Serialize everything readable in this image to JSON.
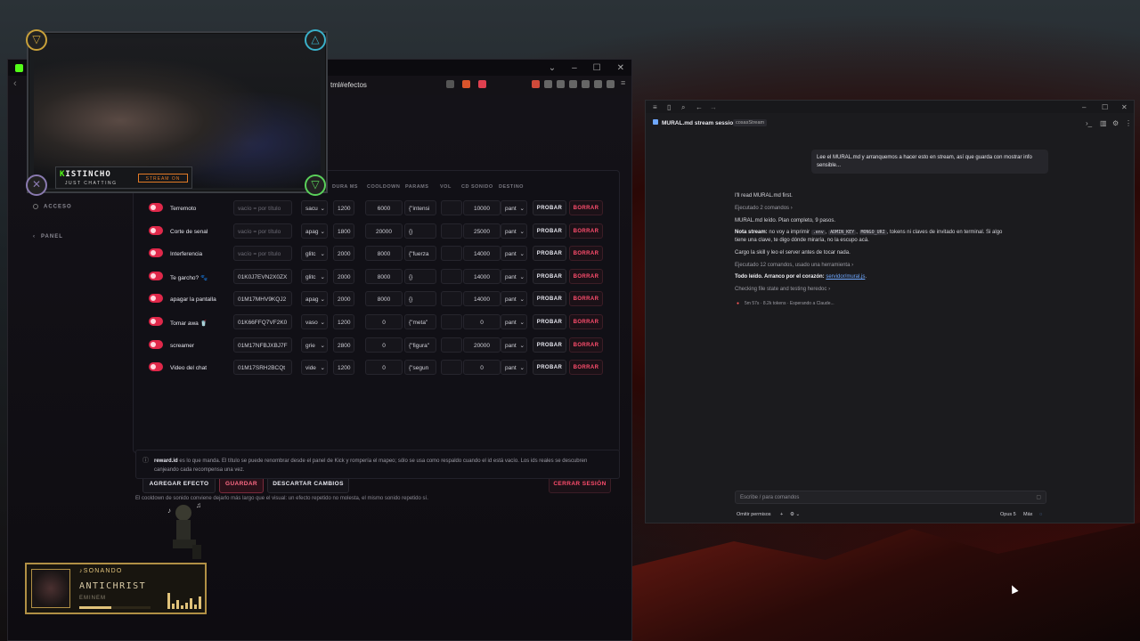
{
  "browser": {
    "url": "tml#efectos",
    "sidebar": [
      {
        "label": "ACCESO"
      },
      {
        "label": "PANEL"
      }
    ],
    "columns": [
      "DURA MS",
      "COOLDOWN",
      "PARAMS",
      "VOL",
      "CD SONIDO",
      "DESTINO"
    ],
    "placeholder_title": "vacío = por título",
    "effects": [
      {
        "name": "Terremoto",
        "reward_id": "vacío = por título",
        "reward_is_placeholder": true,
        "type": "sacu",
        "duration": "1200",
        "cooldown": "6000",
        "params": "{\"intensi",
        "sound_cd": "10000",
        "target": "pant"
      },
      {
        "name": "Corte de senal",
        "reward_id": "vacío = por título",
        "reward_is_placeholder": true,
        "type": "apag",
        "duration": "1800",
        "cooldown": "20000",
        "params": "{}",
        "sound_cd": "25000",
        "target": "pant"
      },
      {
        "name": "Interferencia",
        "reward_id": "vacío = por título",
        "reward_is_placeholder": true,
        "type": "glitc",
        "duration": "2000",
        "cooldown": "8000",
        "params": "{\"fuerza",
        "sound_cd": "14000",
        "target": "pant"
      },
      {
        "name": "Te garcho? 🐾",
        "reward_id": "01K0J7EVN2X0ZX",
        "reward_is_placeholder": false,
        "type": "glitc",
        "duration": "2000",
        "cooldown": "8000",
        "params": "{}",
        "sound_cd": "14000",
        "target": "pant"
      },
      {
        "name": "apagar la pantalla",
        "reward_id": "01M17MHV9KQJ2",
        "reward_is_placeholder": false,
        "type": "apag",
        "duration": "2000",
        "cooldown": "8000",
        "params": "{}",
        "sound_cd": "14000",
        "target": "pant"
      },
      {
        "name": "Tomar awa 🥤",
        "reward_id": "01K66FFQ7VF2K0",
        "reward_is_placeholder": false,
        "type": "vaso",
        "duration": "1200",
        "cooldown": "0",
        "params": "{\"meta\"",
        "sound_cd": "0",
        "target": "pant"
      },
      {
        "name": "screamer",
        "reward_id": "01M17NFBJXBJ7F",
        "reward_is_placeholder": false,
        "type": "grie",
        "duration": "2800",
        "cooldown": "0",
        "params": "{\"figura\"",
        "sound_cd": "20000",
        "target": "pant"
      },
      {
        "name": "Video del chat",
        "reward_id": "01M17SRH2BCQt",
        "reward_is_placeholder": false,
        "type": "vide",
        "duration": "1200",
        "cooldown": "0",
        "params": "{\"segun",
        "sound_cd": "0",
        "target": "pant"
      }
    ],
    "row_buttons": {
      "test": "PROBAR",
      "delete": "BORRAR"
    },
    "actions": {
      "add": "AGREGAR EFECTO",
      "save": "GUARDAR",
      "discard": "DESCARTAR CAMBIOS",
      "logout": "CERRAR SESIÓN"
    },
    "info_bold": "reward.id",
    "info_text": " es lo que manda. El título se puede renombrar desde el panel de Kick y rompería el mapeo; sólo se usa como respaldo cuando el id está vacío. Los ids reales se descubren canjeando cada recompensa una vez.",
    "note": "El cooldown de sonido conviene dejarlo más largo que el visual: un efecto repetido no molesta, el mismo sonido repetido sí."
  },
  "stream": {
    "name_k": "K",
    "name_rest": "ISTINCHO",
    "subtitle": "JUST CHATTING",
    "live_badge": "STREAM ON"
  },
  "music": {
    "status": "♪SONANDO",
    "title": "ANTICHRIST",
    "artist": "EMINEM",
    "progress": 0.45
  },
  "terminal": {
    "session_title": "MURAL.md stream session",
    "session_tag": "cosasStream",
    "user_message": "Lee el MURAL.md y arranquemos a hacer esto en stream, así que guarda con mostrar info sensible...",
    "lines": {
      "l1": "I'll read MURAL.md first.",
      "l2": "Ejecutado 2 comandos ›",
      "l3": "MURAL.md leído. Plan completo, 9 pasos.",
      "l4_bold": "Nota stream:",
      "l4_a": " no voy a imprimir ",
      "l4_code1": ".env",
      "l4_sep1": ", ",
      "l4_code2": "ADMIN_KEY",
      "l4_sep2": ", ",
      "l4_code3": "MONGO_URI",
      "l4_b": ", tokens ni claves de invitado en terminal. Si algo",
      "l4_c": "tiene una clave, te digo dónde miraría, no la escupo acá.",
      "l5": "Cargo la skill y leo el server antes de tocar nada.",
      "l6": "Ejecutado 12 comandos, usado una herramienta ›",
      "l7_bold": "Todo leído. Arranco por el corazón: ",
      "l7_link": "servidor/mural.js",
      "l7_end": ".",
      "l8": "Checking file state and testing heredoc ›",
      "spinner": "5m 57s · 8.2k tokens · Esperando a Claude..."
    },
    "prompt_placeholder": "Escribe / para comandos",
    "footer_left": "Omitir permisos",
    "footer_plus": "+",
    "model": "Opus 5",
    "mode": "Máx"
  }
}
